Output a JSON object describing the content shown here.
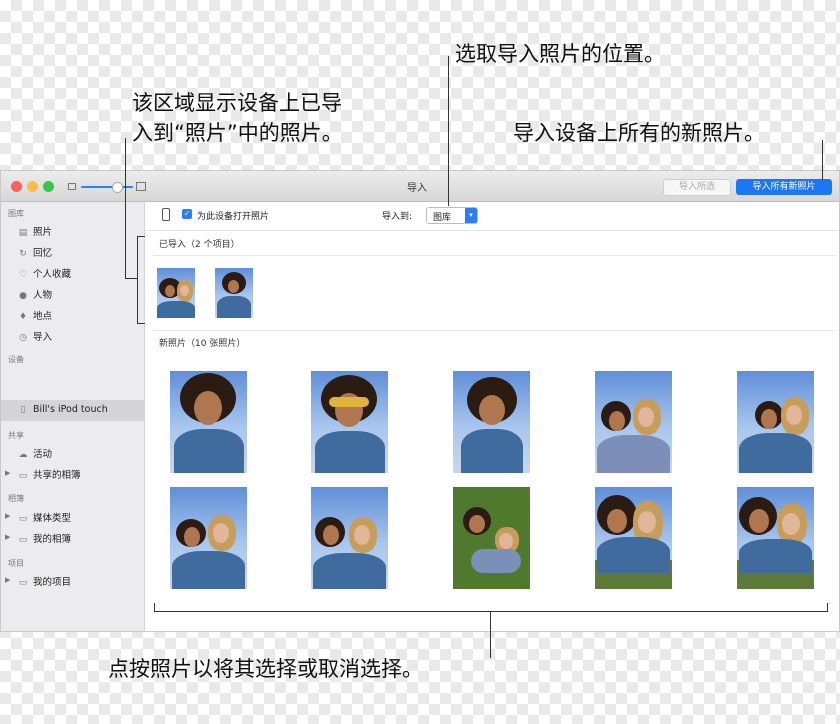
{
  "callouts": {
    "import_location": "选取导入照片的位置。",
    "imported_area_line1": "该区域显示设备上已导",
    "imported_area_line2": "入到“照片”中的照片。",
    "import_all": "导入设备上所有的新照片。",
    "click_photos": "点按照片以将其选择或取消选择。"
  },
  "window": {
    "title": "导入",
    "import_selected": "导入所选",
    "import_all_new": "导入所有新照片",
    "traffic_colors": [
      "#fc605c",
      "#fdbc40",
      "#34c84a"
    ]
  },
  "toolbar": {
    "device_icon": "iphone-icon",
    "open_photos_checkbox": "为此设备打开照片",
    "import_to_label": "导入到:",
    "import_to_value": "图库"
  },
  "sidebar": {
    "library_header": "图库",
    "library_items": [
      {
        "label": "照片",
        "icon": "photos-icon"
      },
      {
        "label": "回忆",
        "icon": "memories-icon"
      },
      {
        "label": "个人收藏",
        "icon": "heart-icon"
      },
      {
        "label": "人物",
        "icon": "person-icon"
      },
      {
        "label": "地点",
        "icon": "pin-icon"
      },
      {
        "label": "导入",
        "icon": "clock-icon"
      }
    ],
    "devices_header": "设备",
    "device_item": "Bill's iPod touch",
    "shared_header": "共享",
    "shared_items": [
      {
        "label": "活动",
        "icon": "cloud-icon"
      },
      {
        "label": "共享的相簿",
        "icon": "folder-icon"
      }
    ],
    "albums_header": "相簿",
    "albums_items": [
      {
        "label": "媒体类型",
        "icon": "folder-icon"
      },
      {
        "label": "我的相簿",
        "icon": "folder-icon"
      }
    ],
    "projects_header": "项目",
    "projects_items": [
      {
        "label": "我的项目",
        "icon": "folder-icon"
      }
    ]
  },
  "imported": {
    "header": "已导入（2 个项目）"
  },
  "new_photos": {
    "header": "新照片（10 张照片）"
  }
}
